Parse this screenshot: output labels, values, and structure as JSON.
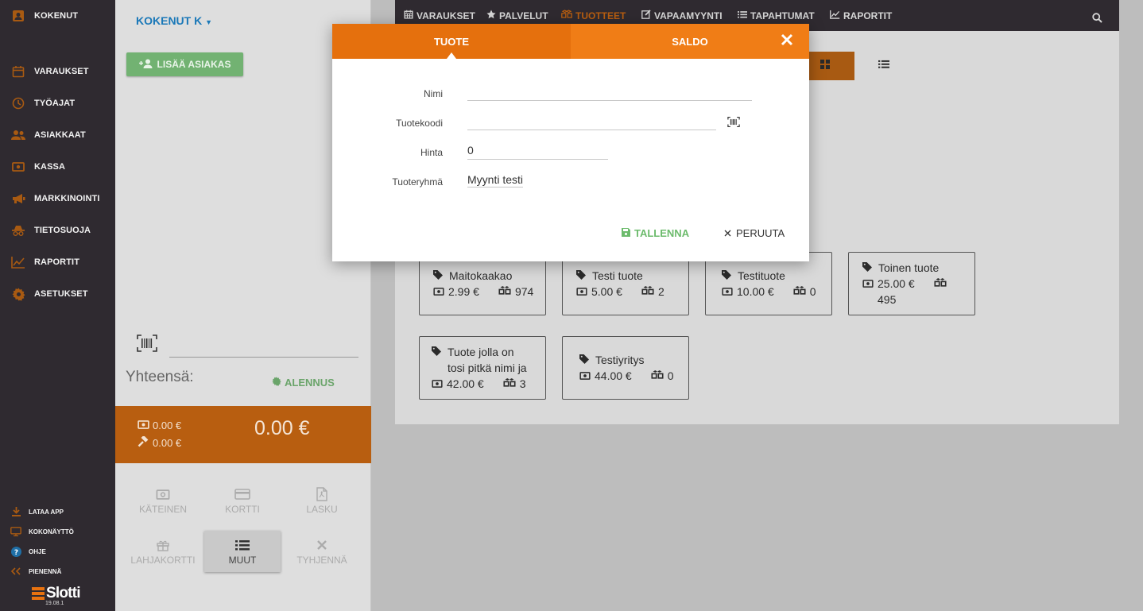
{
  "sidebar": {
    "user": "KOKENUT",
    "items": [
      {
        "label": "VARAUKSET",
        "icon": "calendar-icon"
      },
      {
        "label": "TYÖAJAT",
        "icon": "clock-icon"
      },
      {
        "label": "ASIAKKAAT",
        "icon": "people-icon"
      },
      {
        "label": "KASSA",
        "icon": "cash-icon"
      },
      {
        "label": "MARKKINOINTI",
        "icon": "megaphone-icon"
      },
      {
        "label": "TIETOSUOJA",
        "icon": "spy-icon"
      },
      {
        "label": "RAPORTIT",
        "icon": "chart-line-icon"
      },
      {
        "label": "ASETUKSET",
        "icon": "gear-icon"
      }
    ],
    "bottom": [
      {
        "label": "LATAA APP",
        "icon": "download-icon"
      },
      {
        "label": "KOKONÄYTTÖ",
        "icon": "monitor-icon"
      },
      {
        "label": "OHJE",
        "icon": "help-icon"
      },
      {
        "label": "PIENENNÄ",
        "icon": "collapse-icon"
      }
    ],
    "logo": "Slotti",
    "version": "19.08.1"
  },
  "register": {
    "customer": "KOKENUT K",
    "add_customer": "LISÄÄ ASIAKAS",
    "total_label": "Yhteensä:",
    "discount": "ALENNUS",
    "subtotal_cash": "0.00 €",
    "subtotal_tip": "0.00 €",
    "total": "0.00 €",
    "pay_buttons": [
      "KÄTEINEN",
      "KORTTI",
      "LASKU",
      "LAHJAKORTTI",
      "MUUT",
      "TYHJENNÄ"
    ]
  },
  "topnav": {
    "tabs": [
      "VARAUKSET",
      "PALVELUT",
      "TUOTTEET",
      "VAPAAMYYNTI",
      "TAPAHTUMAT",
      "RAPORTIT"
    ],
    "active": "TUOTTEET"
  },
  "products": [
    {
      "name": "Maitokaakao",
      "price": "2.99 €",
      "stock": "974"
    },
    {
      "name": "Testi tuote",
      "price": "5.00 €",
      "stock": "2"
    },
    {
      "name": "Testituote",
      "price": "10.00 €",
      "stock": "0"
    },
    {
      "name": "Toinen tuote",
      "price": "25.00 €",
      "stock": "495"
    },
    {
      "name_line1": "Tuote jolla on",
      "name_line2": "tosi pitkä nimi ja",
      "price": "42.00 €",
      "stock": "3"
    },
    {
      "name": "Testiyritys",
      "price": "44.00 €",
      "stock": "0"
    }
  ],
  "modal": {
    "tabs": [
      "TUOTE",
      "SALDO"
    ],
    "active_tab": "TUOTE",
    "fields": {
      "name_label": "Nimi",
      "name_value": "",
      "code_label": "Tuotekoodi",
      "code_value": "",
      "price_label": "Hinta",
      "price_value": "0",
      "group_label": "Tuoteryhmä",
      "group_value": "Myynti testi"
    },
    "save": "TALLENNA",
    "cancel": "PERUUTA"
  },
  "colors": {
    "accent": "#e8720f",
    "sidebar": "#2f2a30",
    "link": "#1a78b8",
    "success": "#6cbb6c"
  }
}
